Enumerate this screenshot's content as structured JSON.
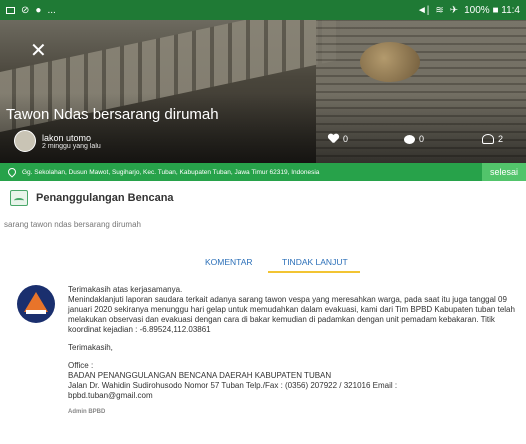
{
  "status_bar": {
    "left_icons": [
      "image-icon",
      "signal-sync-icon",
      "circle-app-icon"
    ],
    "left_text": "...",
    "right_text": "100% ■ 11:4"
  },
  "hero": {
    "close_symbol": "✕",
    "title": "Tawon Ndas bersarang dirumah",
    "author_name": "lakon utomo",
    "author_time": "2 minggu yang lalu",
    "likes": "0",
    "comments": "0",
    "followers": "2"
  },
  "location": {
    "address": "Gg. Sekolahan, Dusun Mawot, Sugiharjo, Kec. Tuban, Kabupaten Tuban, Jawa Timur 62319, Indonesia",
    "status_button": "selesai"
  },
  "category": {
    "title": "Penanggulangan Bencana",
    "description": "sarang tawon ndas bersarang dirumah"
  },
  "tabs": [
    {
      "label": "KOMENTAR"
    },
    {
      "label": "TINDAK LANJUT"
    }
  ],
  "message": {
    "line1": "Terimakasih atas kerjasamanya.",
    "body": "Menindaklanjuti laporan saudara terkait adanya sarang tawon vespa yang meresahkan warga, pada saat itu juga tanggal 09 januari 2020 sekiranya menunggu hari gelap untuk memudahkan dalam evakuasi, kami dari Tim BPBD Kabupaten tuban telah melakukan observasi dan evakuasi dengan cara di bakar kemudian di padamkan dengan unit pemadam kebakaran. Titik koordinat kejadian : -6.89524,112.03861",
    "thanks": "Terimakasih,",
    "office_label": "Office :",
    "office_name": "BADAN PENANGGULANGAN BENCANA DAERAH KABUPATEN TUBAN",
    "office_address": "Jalan Dr. Wahidin Sudirohusodo Nomor 57 Tuban Telp./Fax : (0356) 207922 / 321016 Email :",
    "office_email": "bpbd.tuban@gmail.com",
    "admin": "Admin BPBD"
  }
}
